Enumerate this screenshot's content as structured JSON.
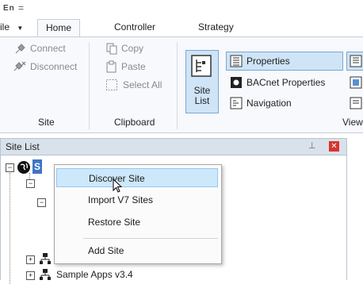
{
  "qat": {
    "app_label": "En",
    "customize_glyph": "="
  },
  "tabs": [
    {
      "label": "ile"
    },
    {
      "label": "Home"
    },
    {
      "label": "Controller"
    },
    {
      "label": "Strategy"
    }
  ],
  "ribbon": {
    "site_group": {
      "label": "Site",
      "connect": "Connect",
      "disconnect": "Disconnect"
    },
    "clipboard_group": {
      "label": "Clipboard",
      "copy": "Copy",
      "paste": "Paste",
      "select_all": "Select All"
    },
    "view_group": {
      "label": "View",
      "site_list_line1": "Site",
      "site_list_line2": "List",
      "properties": "Properties",
      "bacnet_properties": "BACnet Properties",
      "navigation": "Navigation"
    }
  },
  "site_list": {
    "title": "Site List",
    "root_label": "S",
    "sample_apps": "Sample Apps v3.4"
  },
  "context_menu": {
    "items": [
      "Discover Site",
      "Import V7 Sites",
      "Restore Site",
      "Add Site"
    ]
  },
  "colors": {
    "accent": "#cde8fb",
    "close": "#d8342c"
  }
}
